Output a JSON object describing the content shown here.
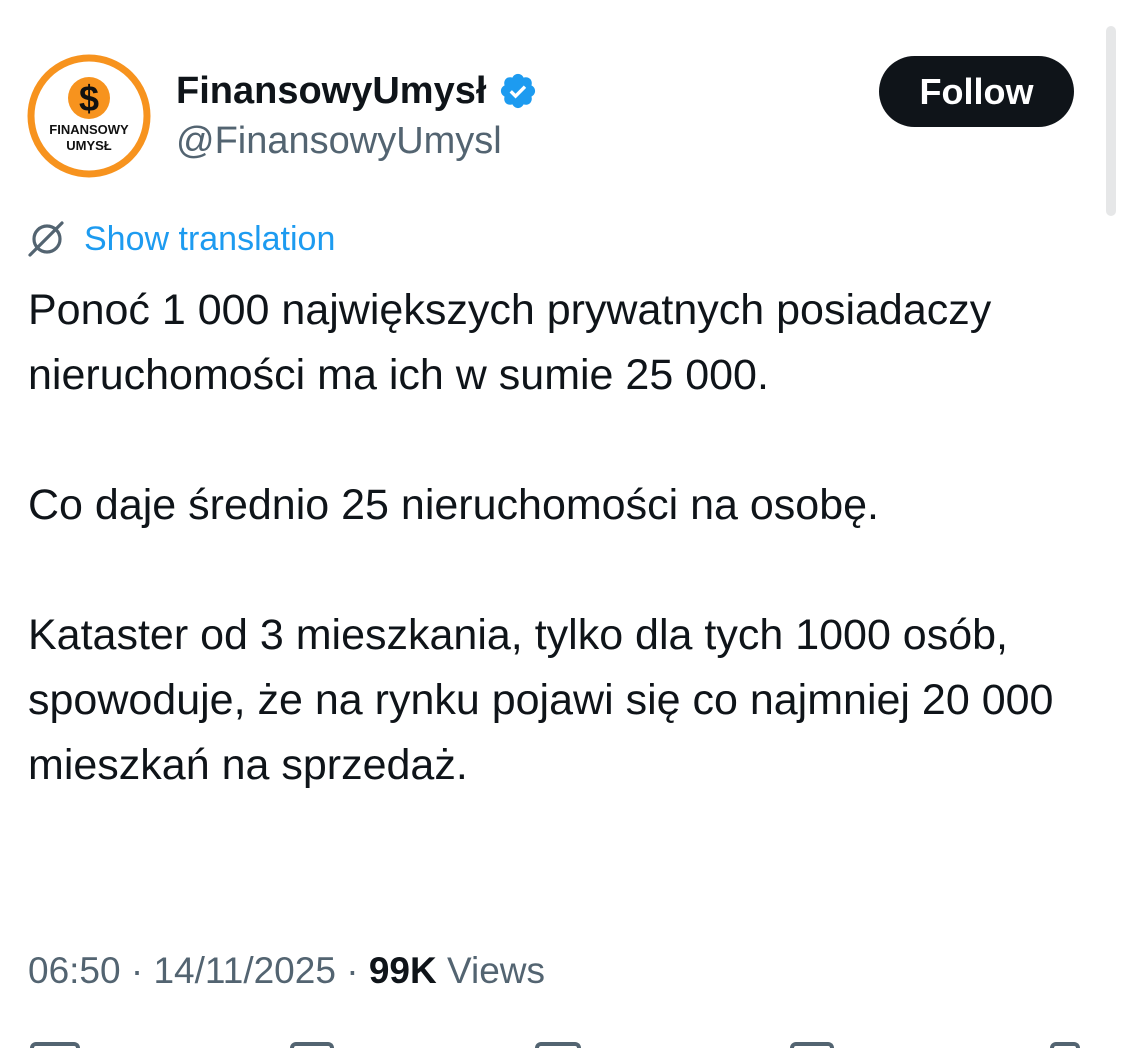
{
  "author": {
    "display_name": "FinansowyUmysł",
    "handle": "@FinansowyUmysl",
    "verified": true,
    "avatar": {
      "icon": "dollar-sign-icon",
      "logo_line1": "FINANSOWY",
      "logo_line2": "UMYSŁ"
    }
  },
  "follow_button": {
    "label": "Follow"
  },
  "translation": {
    "icon": "translate-icon",
    "label": "Show translation"
  },
  "tweet": {
    "paragraphs": [
      "Ponoć 1 000 największych prywatnych posiadaczy nieruchomości ma ich w sumie 25 000.",
      "Co daje średnio 25 nieruchomości na osobę.",
      "Kataster od 3 mieszkania, tylko dla tych 1000 osób, spowoduje, że na rynku pojawi się co najmniej 20 000 mieszkań na sprzedaż."
    ]
  },
  "meta": {
    "time": "06:50",
    "separator": "·",
    "date": "14/11/2025",
    "views_count": "99K",
    "views_label": "Views"
  },
  "colors": {
    "text": "#0f1419",
    "secondary": "#536471",
    "link": "#1d9bf0",
    "verified": "#1d9bf0",
    "avatar_ring": "#f7931e",
    "follow_bg": "#0f1419"
  },
  "action_bar": {
    "icons": [
      "reply-icon",
      "repost-icon",
      "like-icon",
      "bookmark-icon",
      "share-icon"
    ]
  }
}
